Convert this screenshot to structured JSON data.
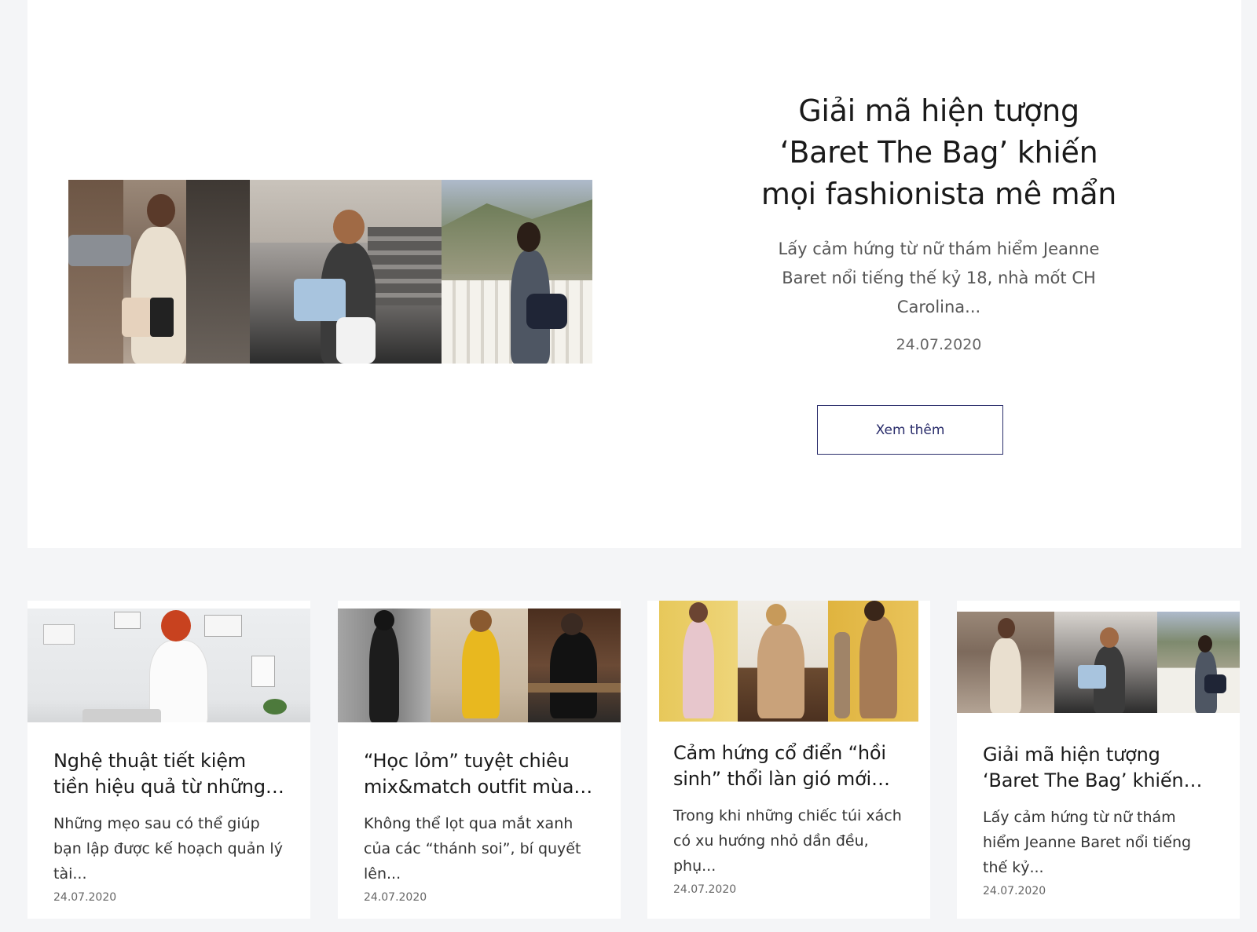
{
  "hero": {
    "title": "Giải mã hiện tượng ‘Baret The Bag’ khiến mọi fashionista mê mẩn",
    "excerpt": "Lấy cảm hứng từ nữ thám hiểm Jeanne Baret nổi tiếng thế kỷ 18, nhà mốt CH Carolina...",
    "date": "24.07.2020",
    "button_label": "Xem thêm"
  },
  "cards": [
    {
      "title": "Nghệ thuật tiết kiệm tiền hiệu quả từ những tín đồ thời trang",
      "excerpt": "Những mẹo sau có thể giúp bạn lập được kế hoạch quản lý tài...",
      "date": "24.07.2020"
    },
    {
      "title": "“Học lỏm” tuyệt chiêu mix&match outfit mùa hè",
      "excerpt": "Không thể lọt qua mắt xanh của các “thánh soi”, bí quyết lên...",
      "date": "24.07.2020"
    },
    {
      "title": "Cảm hứng cổ điển “hồi sinh” thổi làn gió mới vào thời trang",
      "excerpt": "Trong khi những chiếc túi xách có xu hướng nhỏ dần đều, phụ...",
      "date": "24.07.2020"
    },
    {
      "title": "Giải mã hiện tượng ‘Baret The Bag’ khiến mọi fashionista mê mẩn",
      "excerpt": "Lấy cảm hứng từ nữ thám hiểm Jeanne Baret nổi tiếng thế kỷ...",
      "date": "24.07.2020"
    }
  ]
}
